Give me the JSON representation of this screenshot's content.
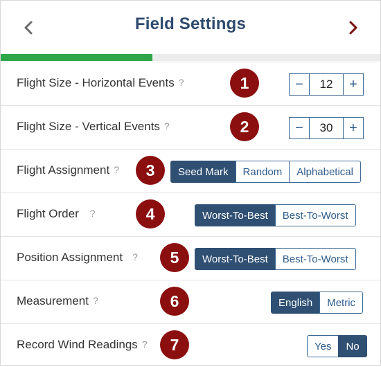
{
  "header": {
    "title": "Field Settings",
    "prev_icon": "chevron-left-icon",
    "next_icon": "chevron-right-icon",
    "progress_fraction": 0.4
  },
  "colors": {
    "title": "#2e4a6e",
    "accent": "#2f4f73",
    "badge": "#8b0f0f",
    "progress": "#2ea64a"
  },
  "rows": [
    {
      "label": "Flight Size - Horizontal Events",
      "badge": "1",
      "help": "?",
      "stepper": {
        "minus": "−",
        "value": "12",
        "plus": "+"
      }
    },
    {
      "label": "Flight Size - Vertical Events",
      "badge": "2",
      "help": "?",
      "stepper": {
        "minus": "−",
        "value": "30",
        "plus": "+"
      }
    },
    {
      "label": "Flight Assignment",
      "badge": "3",
      "help": "?",
      "options": [
        "Seed Mark",
        "Random",
        "Alphabetical"
      ],
      "selected": "Seed Mark"
    },
    {
      "label": "Flight Order",
      "badge": "4",
      "help": "?",
      "options": [
        "Worst-To-Best",
        "Best-To-Worst"
      ],
      "selected": "Worst-To-Best"
    },
    {
      "label": "Position Assignment",
      "badge": "5",
      "help": "?",
      "options": [
        "Worst-To-Best",
        "Best-To-Worst"
      ],
      "selected": "Worst-To-Best"
    },
    {
      "label": "Measurement",
      "badge": "6",
      "help": "?",
      "options": [
        "English",
        "Metric"
      ],
      "selected": "English"
    },
    {
      "label": "Record Wind Readings",
      "badge": "7",
      "help": "?",
      "options": [
        "Yes",
        "No"
      ],
      "selected": "No"
    }
  ]
}
